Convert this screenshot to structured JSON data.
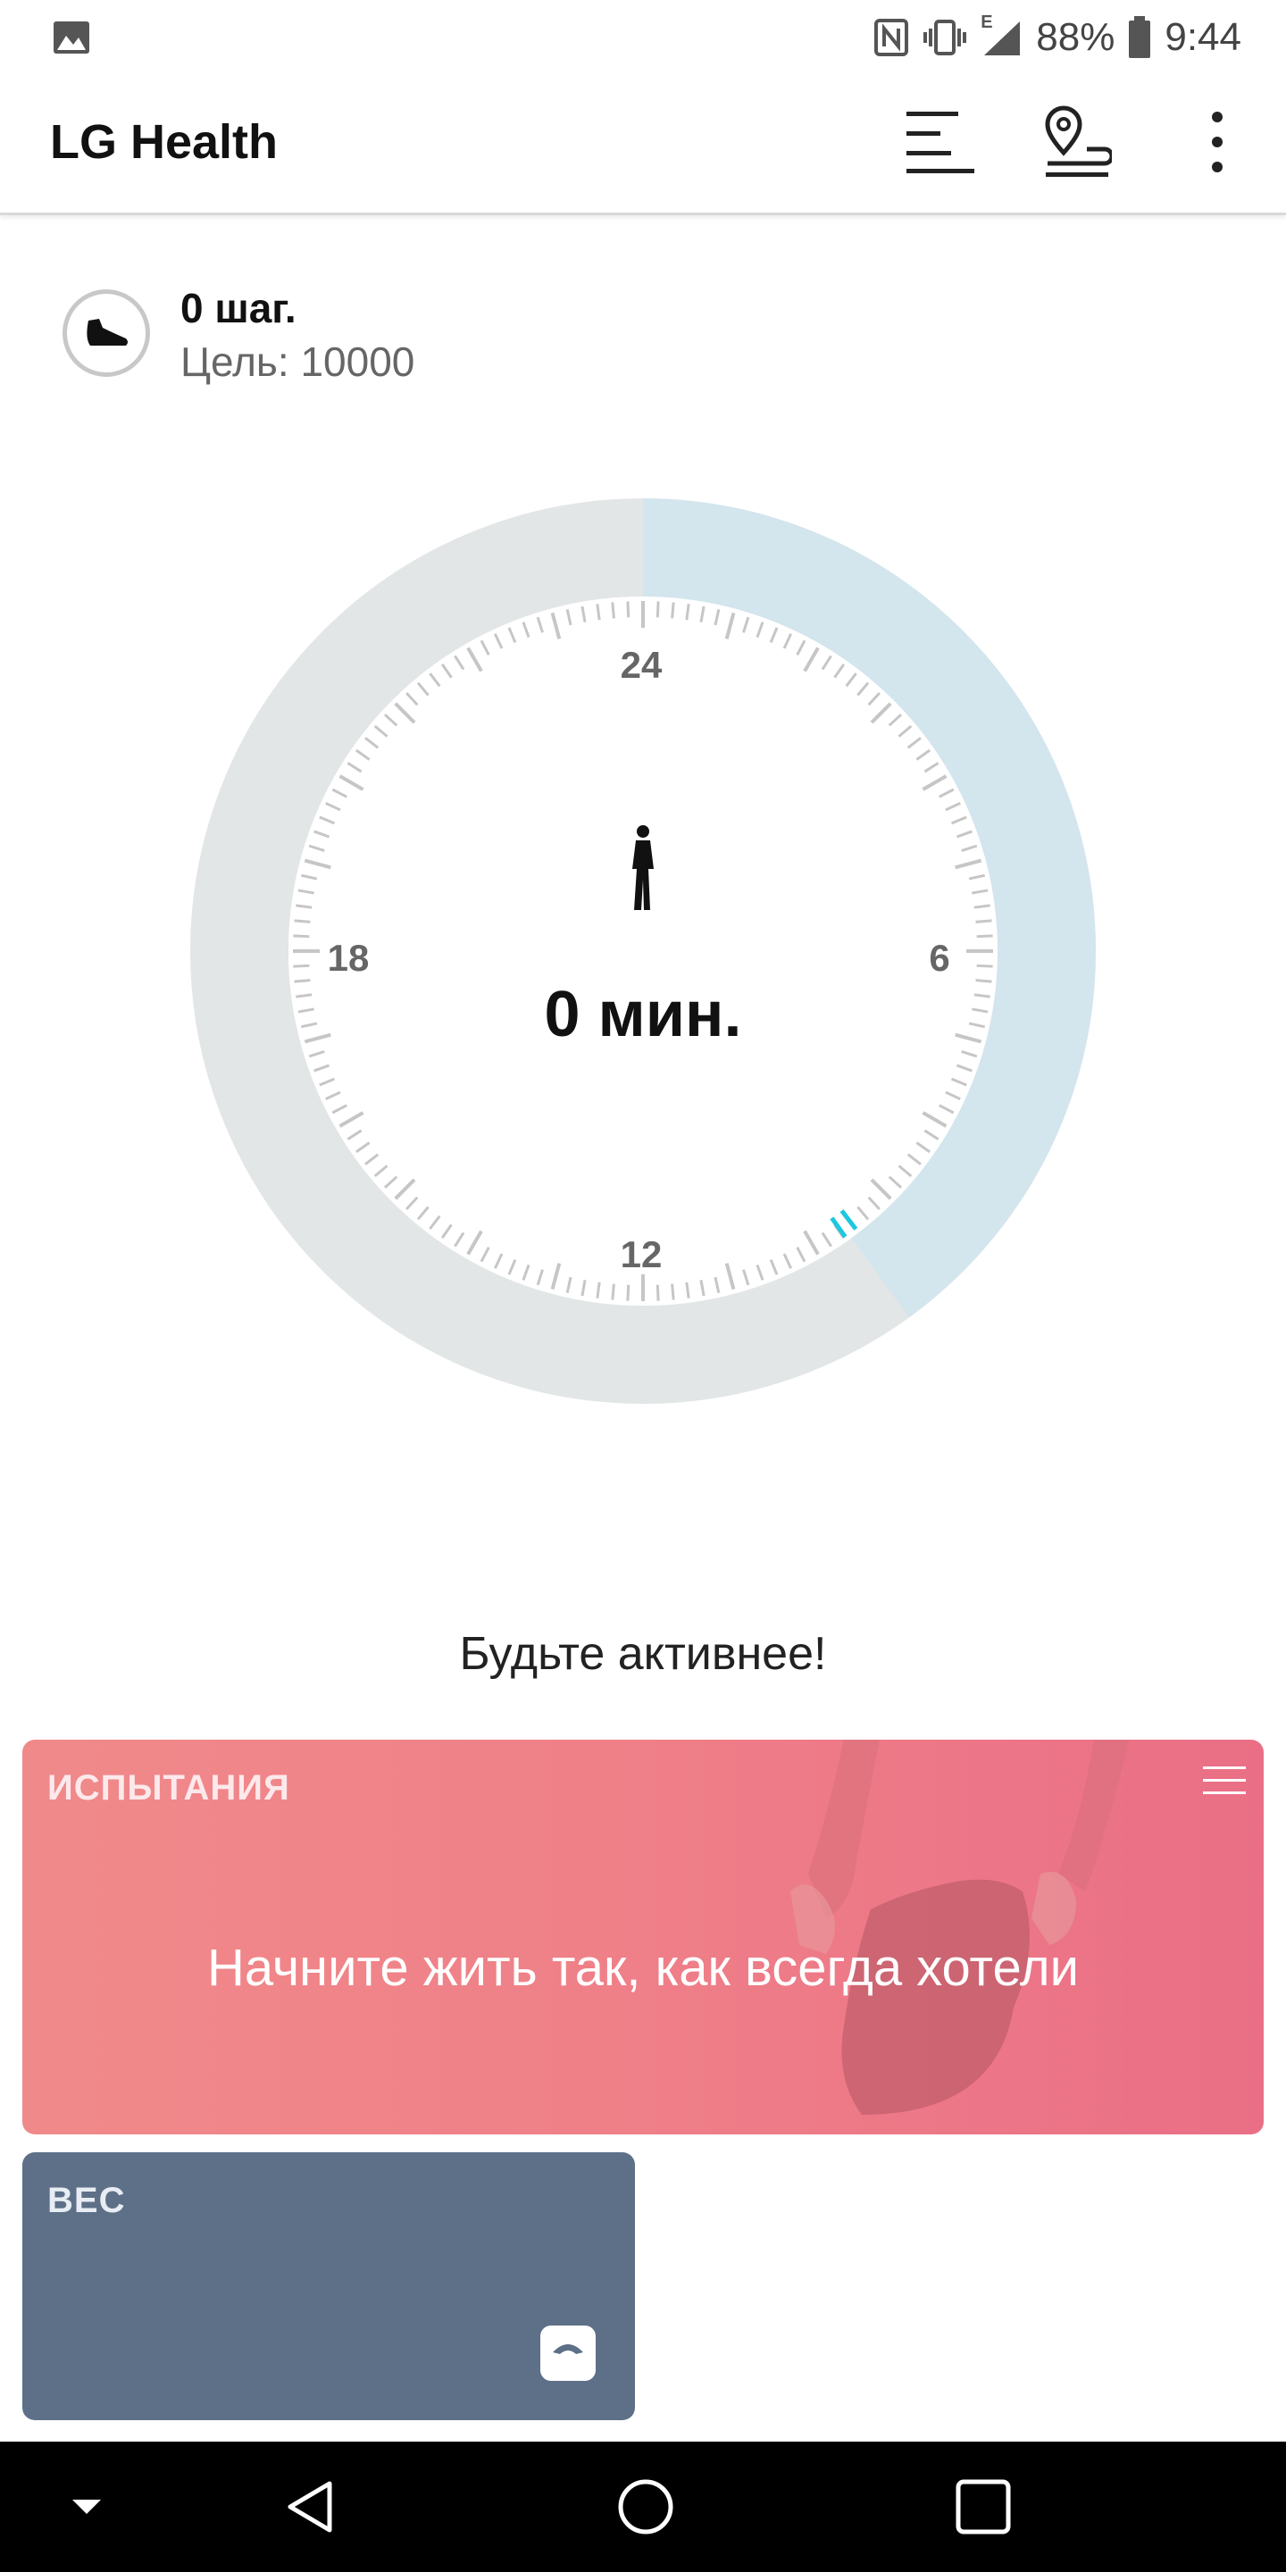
{
  "status_bar": {
    "battery_text": "88%",
    "time": "9:44",
    "network_letter": "E",
    "icons": [
      "gallery-icon",
      "nfc-icon",
      "vibrate-icon",
      "signal-icon",
      "battery-icon"
    ]
  },
  "app_bar": {
    "title": "LG Health",
    "actions": [
      "list-icon",
      "location-pin-icon",
      "more-icon"
    ]
  },
  "steps": {
    "count_text": "0 шаг.",
    "goal_text": "Цель: 10000",
    "icon": "shoe-icon"
  },
  "dial": {
    "labels": {
      "top": "24",
      "right": "6",
      "bottom": "12",
      "left": "18"
    },
    "activity_value": "0 мин.",
    "activity_icon": "walking-person-icon",
    "elapsed_fraction": 0.4,
    "colors": {
      "elapsed": "#d3e5ed",
      "remaining": "#e3e6e7",
      "marker": "#1ec6e0"
    }
  },
  "motivation_text": "Будьте активнее!",
  "challenge_card": {
    "heading": "ИСПЫТАНИЯ",
    "text": "Начните жить так, как всегда хотели"
  },
  "weight_card": {
    "heading": "ВЕС",
    "icon": "scale-icon"
  },
  "nav_bar": {
    "buttons": [
      "hide-keyboard-icon",
      "back-icon",
      "home-icon",
      "recents-icon"
    ]
  }
}
